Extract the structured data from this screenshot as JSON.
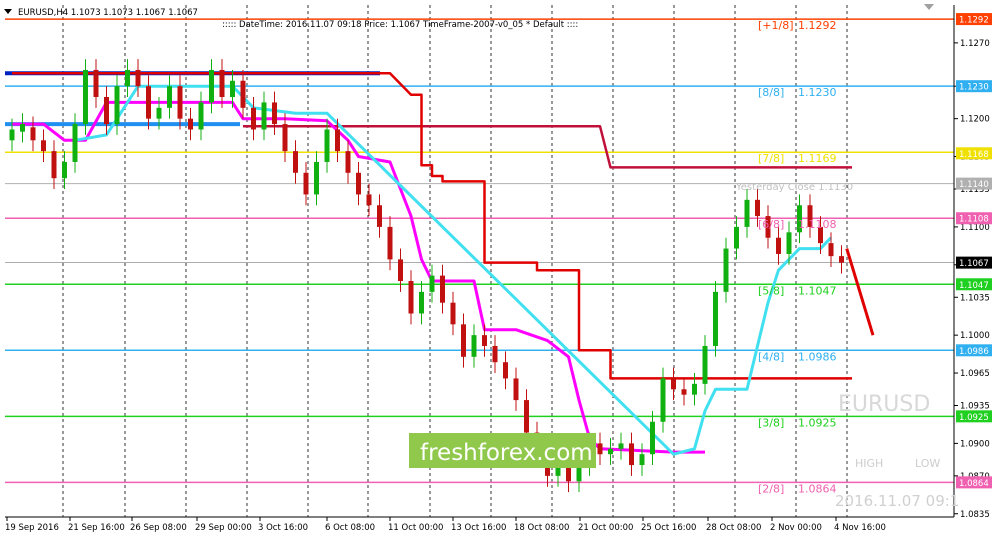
{
  "header": {
    "symbol_line": "EURUSD,H4  1.1073 1.1073 1.1067 1.1067",
    "info_line": "::::: DateTime: 2016.11.07 09:18   Price: 1.1067   TimeFrame-2007-v0_05   *  Default  ::::"
  },
  "watermark": {
    "symbol": "EURUSD",
    "brand": "freshforex.com",
    "timestamp": "2016.11.07 09:1",
    "high_label": "HIGH",
    "low_label": "LOW"
  },
  "yesterday_close_label": "Yesterday Close 1.1130",
  "colors": {
    "bull": "#10b010",
    "bear": "#c01010",
    "grid": "#c8c8c8",
    "magenta": "#ff00ff",
    "cyan": "#40e0f0",
    "red": "#e00000",
    "brand_bg": "#8fc84a"
  },
  "chart_data": {
    "type": "candlestick",
    "symbol": "EURUSD",
    "timeframe": "H4",
    "y_range": [
      1.0832,
      1.1305
    ],
    "y_ticks": [
      "1.1270",
      "1.1230",
      "1.1200",
      "1.1165",
      "1.1135",
      "1.1100",
      "1.1065",
      "1.1035",
      "1.1000",
      "1.0965",
      "1.0935",
      "1.0900",
      "1.0870",
      "1.0835"
    ],
    "x_labels": [
      "19 Sep 2016",
      "21 Sep 16:00",
      "26 Sep 08:00",
      "29 Sep 00:00",
      "3 Oct 16:00",
      "6 Oct 08:00",
      "11 Oct 00:00",
      "13 Oct 16:00",
      "18 Oct 08:00",
      "21 Oct 00:00",
      "25 Oct 16:00",
      "28 Oct 08:00",
      "2 Nov 00:00",
      "4 Nov 16:00"
    ],
    "price_markers": [
      {
        "value": 1.1292,
        "label": "1.1292",
        "color": "#ff4000"
      },
      {
        "value": 1.123,
        "label": "1.1230",
        "color": "#30b0f0"
      },
      {
        "value": 1.1168,
        "label": "1.1168",
        "color": "#f0e000"
      },
      {
        "value": 1.114,
        "label": "1.1140",
        "color": "#b0b0b0"
      },
      {
        "value": 1.1108,
        "label": "1.1108",
        "color": "#f060b0"
      },
      {
        "value": 1.1067,
        "label": "1.1067",
        "color": "#000000"
      },
      {
        "value": 1.1047,
        "label": "1.1047",
        "color": "#20d020"
      },
      {
        "value": 1.0986,
        "label": "1.0986",
        "color": "#30b0f0"
      },
      {
        "value": 1.0925,
        "label": "1.0925",
        "color": "#20d020"
      },
      {
        "value": 1.0864,
        "label": "1.0864",
        "color": "#f060b0"
      }
    ],
    "murrey_levels": [
      {
        "name": "[+1/8]",
        "value_label": "1.1292",
        "value": 1.1292,
        "color": "#ff4000"
      },
      {
        "name": "[8/8]",
        "value_label": "1.1230",
        "value": 1.123,
        "color": "#30b0f0"
      },
      {
        "name": "[7/8]",
        "value_label": "1.1169",
        "value": 1.1169,
        "color": "#f0e000"
      },
      {
        "name": "[6/8]",
        "value_label": "1.1108",
        "value": 1.1108,
        "color": "#f060b0"
      },
      {
        "name": "[5/8]",
        "value_label": "1.1047",
        "value": 1.1047,
        "color": "#20d020"
      },
      {
        "name": "[4/8]",
        "value_label": "1.0986",
        "value": 1.0986,
        "color": "#30b0f0"
      },
      {
        "name": "[3/8]",
        "value_label": "1.0925",
        "value": 1.0925,
        "color": "#20d020"
      },
      {
        "name": "[2/8]",
        "value_label": "1.0864",
        "value": 1.0864,
        "color": "#f060b0"
      }
    ],
    "gray_line_value": 1.114,
    "current_price_value": 1.1067,
    "blue_channel": [
      {
        "t": 0,
        "value": 1.1242
      },
      {
        "t": 0,
        "value": 1.1195
      }
    ],
    "red_step": [
      {
        "t": 0,
        "value": 1.1242
      },
      {
        "t": 36,
        "value": 1.1242
      },
      {
        "t": 38,
        "value": 1.1222
      },
      {
        "t": 39,
        "value": 1.1222
      },
      {
        "t": 39,
        "value": 1.1157
      },
      {
        "t": 40,
        "value": 1.1157
      },
      {
        "t": 40,
        "value": 1.1147
      },
      {
        "t": 41,
        "value": 1.1147
      },
      {
        "t": 41,
        "value": 1.1142
      },
      {
        "t": 45,
        "value": 1.1142
      },
      {
        "t": 45,
        "value": 1.1067
      },
      {
        "t": 50,
        "value": 1.1067
      },
      {
        "t": 50,
        "value": 1.106
      },
      {
        "t": 54,
        "value": 1.106
      },
      {
        "t": 54,
        "value": 1.0986
      },
      {
        "t": 57,
        "value": 1.0986
      },
      {
        "t": 57,
        "value": 1.096
      },
      {
        "t": 80,
        "value": 1.096
      }
    ],
    "crimson_step": [
      {
        "t": 22,
        "value": 1.1193
      },
      {
        "t": 56,
        "value": 1.1193
      },
      {
        "t": 57,
        "value": 1.1155
      },
      {
        "t": 80,
        "value": 1.1155
      }
    ],
    "magenta_ma": [
      {
        "t": 0,
        "value": 1.1195
      },
      {
        "t": 3,
        "value": 1.1195
      },
      {
        "t": 5,
        "value": 1.118
      },
      {
        "t": 7,
        "value": 1.118
      },
      {
        "t": 9,
        "value": 1.1215
      },
      {
        "t": 14,
        "value": 1.1215
      },
      {
        "t": 17,
        "value": 1.1215
      },
      {
        "t": 21,
        "value": 1.1215
      },
      {
        "t": 22,
        "value": 1.12
      },
      {
        "t": 26,
        "value": 1.12
      },
      {
        "t": 30,
        "value": 1.1198
      },
      {
        "t": 32,
        "value": 1.118
      },
      {
        "t": 33,
        "value": 1.1165
      },
      {
        "t": 36,
        "value": 1.116
      },
      {
        "t": 37,
        "value": 1.1135
      },
      {
        "t": 38,
        "value": 1.111
      },
      {
        "t": 39,
        "value": 1.107
      },
      {
        "t": 40,
        "value": 1.105
      },
      {
        "t": 44,
        "value": 1.105
      },
      {
        "t": 45,
        "value": 1.1005
      },
      {
        "t": 48,
        "value": 1.1005
      },
      {
        "t": 51,
        "value": 1.0995
      },
      {
        "t": 53,
        "value": 1.098
      },
      {
        "t": 54,
        "value": 1.094
      },
      {
        "t": 55,
        "value": 1.0905
      },
      {
        "t": 56,
        "value": 1.0895
      },
      {
        "t": 63,
        "value": 1.0892
      },
      {
        "t": 66,
        "value": 1.0892
      }
    ],
    "cyan_ma": [
      {
        "t": 6,
        "value": 1.118
      },
      {
        "t": 9,
        "value": 1.1185
      },
      {
        "t": 10,
        "value": 1.12
      },
      {
        "t": 12,
        "value": 1.123
      },
      {
        "t": 21,
        "value": 1.123
      },
      {
        "t": 23,
        "value": 1.121
      },
      {
        "t": 27,
        "value": 1.1205
      },
      {
        "t": 30,
        "value": 1.1205
      },
      {
        "t": 63,
        "value": 1.089
      },
      {
        "t": 65,
        "value": 1.0895
      },
      {
        "t": 66,
        "value": 1.093
      },
      {
        "t": 67,
        "value": 1.095
      },
      {
        "t": 70,
        "value": 1.095
      },
      {
        "t": 71,
        "value": 1.099
      },
      {
        "t": 72,
        "value": 1.103
      },
      {
        "t": 73,
        "value": 1.106
      },
      {
        "t": 75,
        "value": 1.108
      },
      {
        "t": 77,
        "value": 1.108
      },
      {
        "t": 78,
        "value": 1.109
      }
    ],
    "forecast_arrow": [
      {
        "t": 79.5,
        "value": 1.108
      },
      {
        "t": 82,
        "value": 1.1
      }
    ],
    "candles_bottom_up": [
      [
        1.118,
        1.119
      ],
      [
        1.1188,
        1.1195
      ],
      [
        1.1192,
        1.118
      ],
      [
        1.118,
        1.117
      ],
      [
        1.117,
        1.1145
      ],
      [
        1.1145,
        1.116
      ],
      [
        1.116,
        1.1195
      ],
      [
        1.1195,
        1.1245
      ],
      [
        1.1245,
        1.122
      ],
      [
        1.122,
        1.1195
      ],
      [
        1.1195,
        1.123
      ],
      [
        1.123,
        1.1245
      ],
      [
        1.1245,
        1.123
      ],
      [
        1.123,
        1.12
      ],
      [
        1.12,
        1.121
      ],
      [
        1.121,
        1.123
      ],
      [
        1.123,
        1.12
      ],
      [
        1.12,
        1.119
      ],
      [
        1.119,
        1.1215
      ],
      [
        1.1215,
        1.1245
      ],
      [
        1.1245,
        1.122
      ],
      [
        1.122,
        1.1235
      ],
      [
        1.1235,
        1.121
      ],
      [
        1.121,
        1.119
      ],
      [
        1.119,
        1.1215
      ],
      [
        1.1215,
        1.1195
      ],
      [
        1.1195,
        1.117
      ],
      [
        1.117,
        1.115
      ],
      [
        1.115,
        1.113
      ],
      [
        1.113,
        1.116
      ],
      [
        1.116,
        1.119
      ],
      [
        1.119,
        1.117
      ],
      [
        1.117,
        1.115
      ],
      [
        1.115,
        1.113
      ],
      [
        1.113,
        1.112
      ],
      [
        1.112,
        1.11
      ],
      [
        1.11,
        1.107
      ],
      [
        1.107,
        1.105
      ],
      [
        1.105,
        1.102
      ],
      [
        1.102,
        1.104
      ],
      [
        1.104,
        1.1055
      ],
      [
        1.1055,
        1.103
      ],
      [
        1.103,
        1.101
      ],
      [
        1.101,
        1.098
      ],
      [
        1.098,
        1.1
      ],
      [
        1.1,
        1.099
      ],
      [
        1.099,
        1.0975
      ],
      [
        1.0975,
        1.096
      ],
      [
        1.096,
        1.094
      ],
      [
        1.094,
        1.091
      ],
      [
        1.091,
        1.089
      ],
      [
        1.089,
        1.087
      ],
      [
        1.087,
        1.0885
      ],
      [
        1.0885,
        1.0865
      ],
      [
        1.0865,
        1.088
      ],
      [
        1.088,
        1.09
      ],
      [
        1.09,
        1.089
      ],
      [
        1.089,
        1.0895
      ],
      [
        1.0895,
        1.09
      ],
      [
        1.09,
        1.088
      ],
      [
        1.088,
        1.089
      ],
      [
        1.089,
        1.092
      ],
      [
        1.092,
        1.096
      ],
      [
        1.096,
        1.095
      ],
      [
        1.095,
        1.0945
      ],
      [
        1.0945,
        1.0955
      ],
      [
        1.0955,
        1.099
      ],
      [
        1.099,
        1.104
      ],
      [
        1.104,
        1.108
      ],
      [
        1.108,
        1.11
      ],
      [
        1.11,
        1.1125
      ],
      [
        1.1125,
        1.111
      ],
      [
        1.111,
        1.109
      ],
      [
        1.109,
        1.1075
      ],
      [
        1.1075,
        1.1095
      ],
      [
        1.1095,
        1.112
      ],
      [
        1.112,
        1.11
      ],
      [
        1.11,
        1.1085
      ],
      [
        1.1085,
        1.1073
      ],
      [
        1.1073,
        1.1067
      ]
    ]
  }
}
